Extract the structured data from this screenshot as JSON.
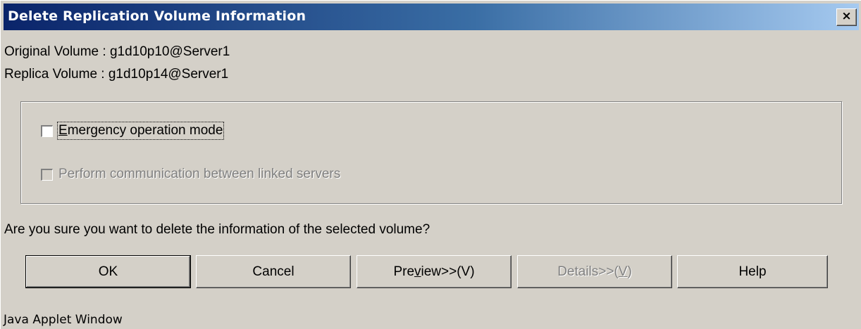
{
  "window": {
    "title": "Delete Replication Volume Information",
    "close_glyph": "×"
  },
  "info": {
    "original": "Original Volume : g1d10p10@Server1",
    "replica": "Replica Volume : g1d10p14@Server1"
  },
  "options": {
    "emergency": {
      "mnemonic": "E",
      "rest": "mergency operation mode",
      "checked": false,
      "enabled": true
    },
    "communicate": {
      "label": "Perform communication between linked servers",
      "checked": false,
      "enabled": false
    }
  },
  "question": "Are you sure you want to delete the information of the selected volume?",
  "buttons": {
    "ok": "OK",
    "cancel": "Cancel",
    "preview": {
      "pre": "Pre",
      "mn": "v",
      "post": "iew>>(V)"
    },
    "details": {
      "pre": "Details>>(",
      "mn": "V",
      "post": ")"
    },
    "help": "Help"
  },
  "status": "Java Applet Window",
  "colors": {
    "titlebar_start": "#0a246a",
    "titlebar_end": "#a6caf0",
    "face": "#d4d0c8",
    "disabled_text": "#808080"
  }
}
